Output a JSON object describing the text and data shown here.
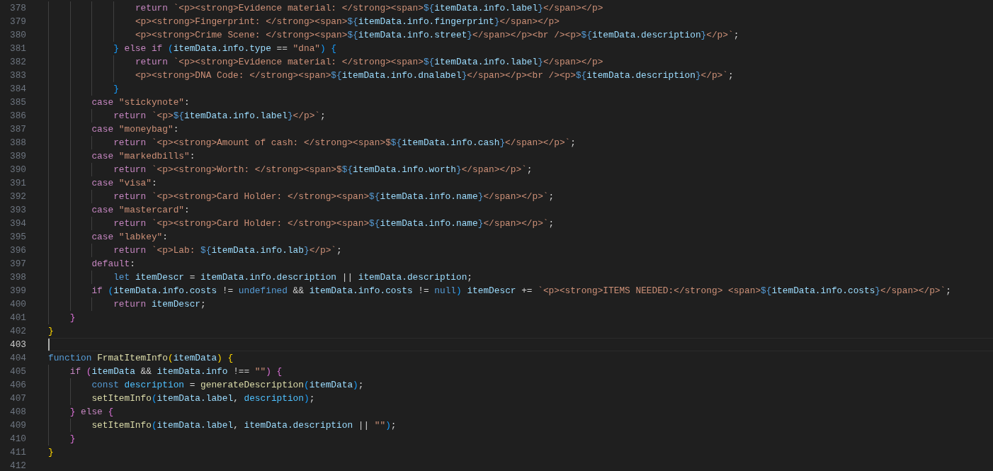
{
  "editor": {
    "lines": [
      {
        "number": "378",
        "current": false,
        "tokens": [
          {
            "kind": "kw",
            "text": "                return "
          },
          {
            "kind": "str",
            "text": "`<p><strong>Evidence material: </strong><span>"
          },
          {
            "kind": "tp",
            "text": "${"
          },
          {
            "kind": "var",
            "text": "itemData.info.label"
          },
          {
            "kind": "tp",
            "text": "}"
          },
          {
            "kind": "str",
            "text": "</span></p>"
          }
        ]
      },
      {
        "number": "379",
        "current": false,
        "tokens": [
          {
            "kind": "str",
            "text": "                <p><strong>Fingerprint: </strong><span>"
          },
          {
            "kind": "tp",
            "text": "${"
          },
          {
            "kind": "var",
            "text": "itemData.info.fingerprint"
          },
          {
            "kind": "tp",
            "text": "}"
          },
          {
            "kind": "str",
            "text": "</span></p>"
          }
        ]
      },
      {
        "number": "380",
        "current": false,
        "tokens": [
          {
            "kind": "str",
            "text": "                <p><strong>Crime Scene: </strong><span>"
          },
          {
            "kind": "tp",
            "text": "${"
          },
          {
            "kind": "var",
            "text": "itemData.info.street"
          },
          {
            "kind": "tp",
            "text": "}"
          },
          {
            "kind": "str",
            "text": "</span></p><br /><p>"
          },
          {
            "kind": "tp",
            "text": "${"
          },
          {
            "kind": "var",
            "text": "itemData.description"
          },
          {
            "kind": "tp",
            "text": "}"
          },
          {
            "kind": "str",
            "text": "</p>`"
          },
          {
            "kind": "p",
            "text": ";"
          }
        ]
      },
      {
        "number": "381",
        "current": false,
        "tokens": [
          {
            "kind": "b3",
            "text": "            } "
          },
          {
            "kind": "kw",
            "text": "else if "
          },
          {
            "kind": "b3",
            "text": "("
          },
          {
            "kind": "var",
            "text": "itemData.info.type"
          },
          {
            "kind": "p",
            "text": " == "
          },
          {
            "kind": "str",
            "text": "\"dna\""
          },
          {
            "kind": "b3",
            "text": ") {"
          }
        ]
      },
      {
        "number": "382",
        "current": false,
        "tokens": [
          {
            "kind": "kw",
            "text": "                return "
          },
          {
            "kind": "str",
            "text": "`<p><strong>Evidence material: </strong><span>"
          },
          {
            "kind": "tp",
            "text": "${"
          },
          {
            "kind": "var",
            "text": "itemData.info.label"
          },
          {
            "kind": "tp",
            "text": "}"
          },
          {
            "kind": "str",
            "text": "</span></p>"
          }
        ]
      },
      {
        "number": "383",
        "current": false,
        "tokens": [
          {
            "kind": "str",
            "text": "                <p><strong>DNA Code: </strong><span>"
          },
          {
            "kind": "tp",
            "text": "${"
          },
          {
            "kind": "var",
            "text": "itemData.info.dnalabel"
          },
          {
            "kind": "tp",
            "text": "}"
          },
          {
            "kind": "str",
            "text": "</span></p><br /><p>"
          },
          {
            "kind": "tp",
            "text": "${"
          },
          {
            "kind": "var",
            "text": "itemData.description"
          },
          {
            "kind": "tp",
            "text": "}"
          },
          {
            "kind": "str",
            "text": "</p>`"
          },
          {
            "kind": "p",
            "text": ";"
          }
        ]
      },
      {
        "number": "384",
        "current": false,
        "tokens": [
          {
            "kind": "b3",
            "text": "            }"
          }
        ]
      },
      {
        "number": "385",
        "current": false,
        "tokens": [
          {
            "kind": "kw",
            "text": "        case "
          },
          {
            "kind": "str",
            "text": "\"stickynote\""
          },
          {
            "kind": "p",
            "text": ":"
          }
        ]
      },
      {
        "number": "386",
        "current": false,
        "tokens": [
          {
            "kind": "kw",
            "text": "            return "
          },
          {
            "kind": "str",
            "text": "`<p>"
          },
          {
            "kind": "tp",
            "text": "${"
          },
          {
            "kind": "var",
            "text": "itemData.info.label"
          },
          {
            "kind": "tp",
            "text": "}"
          },
          {
            "kind": "str",
            "text": "</p>`"
          },
          {
            "kind": "p",
            "text": ";"
          }
        ]
      },
      {
        "number": "387",
        "current": false,
        "tokens": [
          {
            "kind": "kw",
            "text": "        case "
          },
          {
            "kind": "str",
            "text": "\"moneybag\""
          },
          {
            "kind": "p",
            "text": ":"
          }
        ]
      },
      {
        "number": "388",
        "current": false,
        "tokens": [
          {
            "kind": "kw",
            "text": "            return "
          },
          {
            "kind": "str",
            "text": "`<p><strong>Amount of cash: </strong><span>$"
          },
          {
            "kind": "tp",
            "text": "${"
          },
          {
            "kind": "var",
            "text": "itemData.info.cash"
          },
          {
            "kind": "tp",
            "text": "}"
          },
          {
            "kind": "str",
            "text": "</span></p>`"
          },
          {
            "kind": "p",
            "text": ";"
          }
        ]
      },
      {
        "number": "389",
        "current": false,
        "tokens": [
          {
            "kind": "kw",
            "text": "        case "
          },
          {
            "kind": "str",
            "text": "\"markedbills\""
          },
          {
            "kind": "p",
            "text": ":"
          }
        ]
      },
      {
        "number": "390",
        "current": false,
        "tokens": [
          {
            "kind": "kw",
            "text": "            return "
          },
          {
            "kind": "str",
            "text": "`<p><strong>Worth: </strong><span>$"
          },
          {
            "kind": "tp",
            "text": "${"
          },
          {
            "kind": "var",
            "text": "itemData.info.worth"
          },
          {
            "kind": "tp",
            "text": "}"
          },
          {
            "kind": "str",
            "text": "</span></p>`"
          },
          {
            "kind": "p",
            "text": ";"
          }
        ]
      },
      {
        "number": "391",
        "current": false,
        "tokens": [
          {
            "kind": "kw",
            "text": "        case "
          },
          {
            "kind": "str",
            "text": "\"visa\""
          },
          {
            "kind": "p",
            "text": ":"
          }
        ]
      },
      {
        "number": "392",
        "current": false,
        "tokens": [
          {
            "kind": "kw",
            "text": "            return "
          },
          {
            "kind": "str",
            "text": "`<p><strong>Card Holder: </strong><span>"
          },
          {
            "kind": "tp",
            "text": "${"
          },
          {
            "kind": "var",
            "text": "itemData.info.name"
          },
          {
            "kind": "tp",
            "text": "}"
          },
          {
            "kind": "str",
            "text": "</span></p>`"
          },
          {
            "kind": "p",
            "text": ";"
          }
        ]
      },
      {
        "number": "393",
        "current": false,
        "tokens": [
          {
            "kind": "kw",
            "text": "        case "
          },
          {
            "kind": "str",
            "text": "\"mastercard\""
          },
          {
            "kind": "p",
            "text": ":"
          }
        ]
      },
      {
        "number": "394",
        "current": false,
        "tokens": [
          {
            "kind": "kw",
            "text": "            return "
          },
          {
            "kind": "str",
            "text": "`<p><strong>Card Holder: </strong><span>"
          },
          {
            "kind": "tp",
            "text": "${"
          },
          {
            "kind": "var",
            "text": "itemData.info.name"
          },
          {
            "kind": "tp",
            "text": "}"
          },
          {
            "kind": "str",
            "text": "</span></p>`"
          },
          {
            "kind": "p",
            "text": ";"
          }
        ]
      },
      {
        "number": "395",
        "current": false,
        "tokens": [
          {
            "kind": "kw",
            "text": "        case "
          },
          {
            "kind": "str",
            "text": "\"labkey\""
          },
          {
            "kind": "p",
            "text": ":"
          }
        ]
      },
      {
        "number": "396",
        "current": false,
        "tokens": [
          {
            "kind": "kw",
            "text": "            return "
          },
          {
            "kind": "str",
            "text": "`<p>Lab: "
          },
          {
            "kind": "tp",
            "text": "${"
          },
          {
            "kind": "var",
            "text": "itemData.info.lab"
          },
          {
            "kind": "tp",
            "text": "}"
          },
          {
            "kind": "str",
            "text": "</p>`"
          },
          {
            "kind": "p",
            "text": ";"
          }
        ]
      },
      {
        "number": "397",
        "current": false,
        "tokens": [
          {
            "kind": "kw",
            "text": "        default"
          },
          {
            "kind": "p",
            "text": ":"
          }
        ]
      },
      {
        "number": "398",
        "current": false,
        "tokens": [
          {
            "kind": "st",
            "text": "            let "
          },
          {
            "kind": "var",
            "text": "itemDescr"
          },
          {
            "kind": "p",
            "text": " = "
          },
          {
            "kind": "var",
            "text": "itemData.info.description"
          },
          {
            "kind": "p",
            "text": " || "
          },
          {
            "kind": "var",
            "text": "itemData.description"
          },
          {
            "kind": "p",
            "text": ";"
          }
        ]
      },
      {
        "number": "399",
        "current": false,
        "tokens": [
          {
            "kind": "kw",
            "text": "        if "
          },
          {
            "kind": "b3",
            "text": "("
          },
          {
            "kind": "var",
            "text": "itemData.info.costs"
          },
          {
            "kind": "p",
            "text": " != "
          },
          {
            "kind": "st",
            "text": "undefined"
          },
          {
            "kind": "p",
            "text": " && "
          },
          {
            "kind": "var",
            "text": "itemData.info.costs"
          },
          {
            "kind": "p",
            "text": " != "
          },
          {
            "kind": "st",
            "text": "null"
          },
          {
            "kind": "b3",
            "text": ") "
          },
          {
            "kind": "var",
            "text": "itemDescr"
          },
          {
            "kind": "p",
            "text": " += "
          },
          {
            "kind": "str",
            "text": "`<p><strong>ITEMS NEEDED:</strong> <span>"
          },
          {
            "kind": "tp",
            "text": "${"
          },
          {
            "kind": "var",
            "text": "itemData.info.costs"
          },
          {
            "kind": "tp",
            "text": "}"
          },
          {
            "kind": "str",
            "text": "</span></p>`"
          },
          {
            "kind": "p",
            "text": ";"
          }
        ]
      },
      {
        "number": "400",
        "current": false,
        "tokens": [
          {
            "kind": "kw",
            "text": "            return "
          },
          {
            "kind": "var",
            "text": "itemDescr"
          },
          {
            "kind": "p",
            "text": ";"
          }
        ]
      },
      {
        "number": "401",
        "current": false,
        "tokens": [
          {
            "kind": "b2",
            "text": "    }"
          }
        ]
      },
      {
        "number": "402",
        "current": false,
        "tokens": [
          {
            "kind": "b1",
            "text": "}"
          }
        ]
      },
      {
        "number": "403",
        "current": true
      },
      {
        "number": "404",
        "current": false,
        "tokens": [
          {
            "kind": "st",
            "text": "function "
          },
          {
            "kind": "fn",
            "text": "FrmatItemInfo"
          },
          {
            "kind": "b1",
            "text": "("
          },
          {
            "kind": "var",
            "text": "itemData"
          },
          {
            "kind": "b1",
            "text": ") {"
          }
        ]
      },
      {
        "number": "405",
        "current": false,
        "tokens": [
          {
            "kind": "kw",
            "text": "    if "
          },
          {
            "kind": "b2",
            "text": "("
          },
          {
            "kind": "var",
            "text": "itemData"
          },
          {
            "kind": "p",
            "text": " && "
          },
          {
            "kind": "var",
            "text": "itemData.info"
          },
          {
            "kind": "p",
            "text": " !== "
          },
          {
            "kind": "str",
            "text": "\"\""
          },
          {
            "kind": "b2",
            "text": ") {"
          }
        ]
      },
      {
        "number": "406",
        "current": false,
        "tokens": [
          {
            "kind": "st",
            "text": "        const "
          },
          {
            "kind": "const",
            "text": "description"
          },
          {
            "kind": "p",
            "text": " = "
          },
          {
            "kind": "fn",
            "text": "generateDescription"
          },
          {
            "kind": "b3",
            "text": "("
          },
          {
            "kind": "var",
            "text": "itemData"
          },
          {
            "kind": "b3",
            "text": ")"
          },
          {
            "kind": "p",
            "text": ";"
          }
        ]
      },
      {
        "number": "407",
        "current": false,
        "tokens": [
          {
            "kind": "fn",
            "text": "        setItemInfo"
          },
          {
            "kind": "b3",
            "text": "("
          },
          {
            "kind": "var",
            "text": "itemData.label"
          },
          {
            "kind": "p",
            "text": ", "
          },
          {
            "kind": "const",
            "text": "description"
          },
          {
            "kind": "b3",
            "text": ")"
          },
          {
            "kind": "p",
            "text": ";"
          }
        ]
      },
      {
        "number": "408",
        "current": false,
        "tokens": [
          {
            "kind": "b2",
            "text": "    } "
          },
          {
            "kind": "kw",
            "text": "else "
          },
          {
            "kind": "b2",
            "text": "{"
          }
        ]
      },
      {
        "number": "409",
        "current": false,
        "tokens": [
          {
            "kind": "fn",
            "text": "        setItemInfo"
          },
          {
            "kind": "b3",
            "text": "("
          },
          {
            "kind": "var",
            "text": "itemData.label"
          },
          {
            "kind": "p",
            "text": ", "
          },
          {
            "kind": "var",
            "text": "itemData.description"
          },
          {
            "kind": "p",
            "text": " || "
          },
          {
            "kind": "str",
            "text": "\"\""
          },
          {
            "kind": "b3",
            "text": ")"
          },
          {
            "kind": "p",
            "text": ";"
          }
        ]
      },
      {
        "number": "410",
        "current": false,
        "tokens": [
          {
            "kind": "b2",
            "text": "    }"
          }
        ]
      },
      {
        "number": "411",
        "current": false,
        "tokens": [
          {
            "kind": "b1",
            "text": "}"
          }
        ]
      },
      {
        "number": "412",
        "current": false
      }
    ]
  }
}
